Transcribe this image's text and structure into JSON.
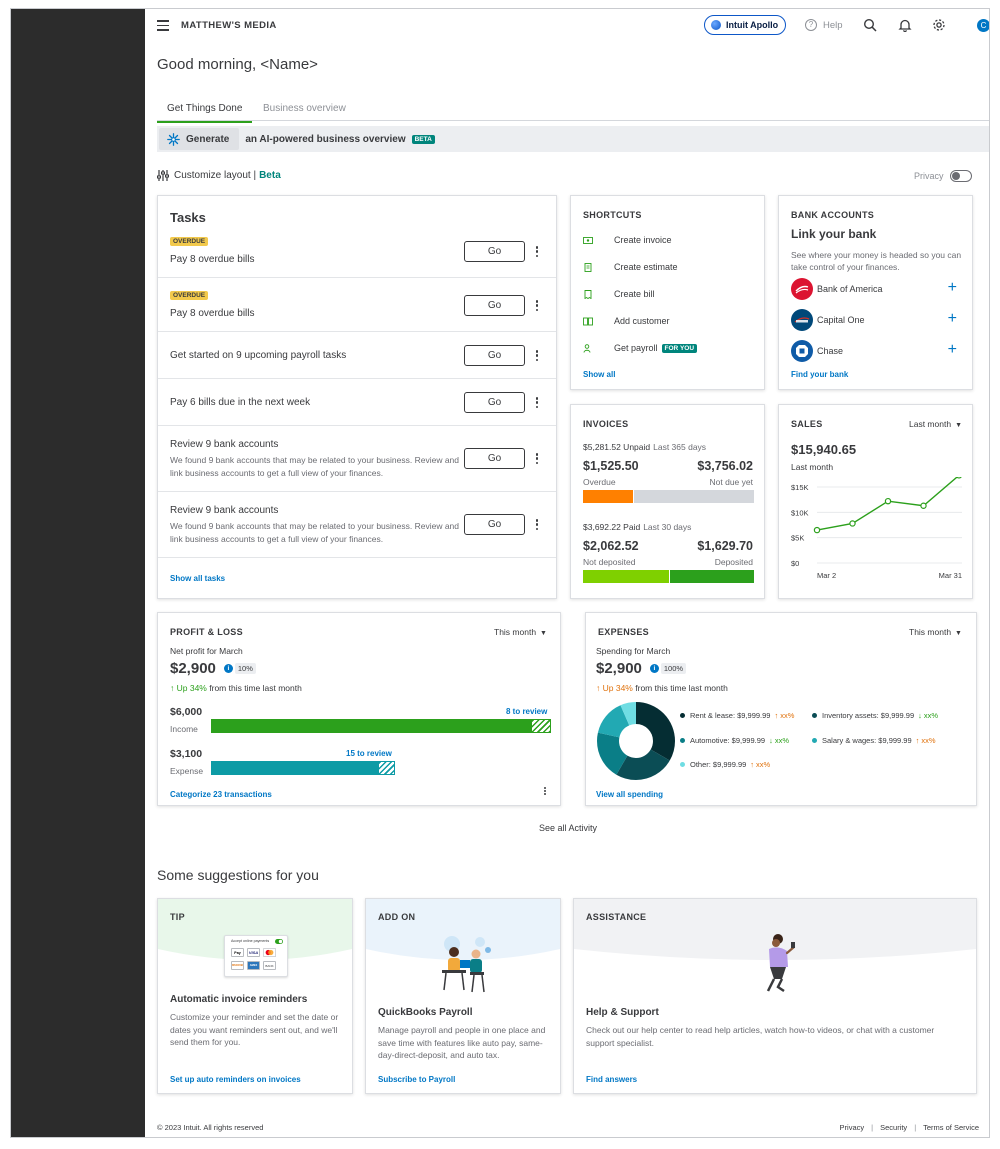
{
  "header": {
    "company": "MATTHEW'S MEDIA",
    "apollo": "Intuit Apollo",
    "help": "Help",
    "avatar": "C"
  },
  "greeting": "Good morning, <Name>",
  "tabs": [
    {
      "label": "Get Things Done",
      "active": true
    },
    {
      "label": "Business overview",
      "active": false
    }
  ],
  "generate": {
    "button": "Generate",
    "text": "an AI-powered business overview",
    "badge": "BETA"
  },
  "customize": {
    "label": "Customize layout |",
    "beta": "Beta"
  },
  "privacy": {
    "label": "Privacy",
    "enabled": false
  },
  "tasks": {
    "title": "Tasks",
    "go_label": "Go",
    "items": [
      {
        "badge": "OVERDUE",
        "title": "Pay 8 overdue bills",
        "description": ""
      },
      {
        "badge": "OVERDUE",
        "title": "Pay 8 overdue bills",
        "description": ""
      },
      {
        "badge": "",
        "title": "Get started on 9 upcoming payroll tasks",
        "description": ""
      },
      {
        "badge": "",
        "title": "Pay 6 bills due in the next week",
        "description": ""
      },
      {
        "badge": "",
        "title": "Review 9 bank accounts",
        "description": "We found 9 bank accounts that may be related to your business. Review and link business accounts to get a full view of your finances."
      },
      {
        "badge": "",
        "title": "Review 9 bank accounts",
        "description": "We found 9 bank accounts that may be related to your business. Review and link business accounts to get a full view of your finances."
      }
    ],
    "show_all": "Show all tasks"
  },
  "shortcuts": {
    "title": "SHORTCUTS",
    "items": [
      {
        "label": "Create invoice",
        "icon": "invoice-icon",
        "badge": ""
      },
      {
        "label": "Create estimate",
        "icon": "estimate-icon",
        "badge": ""
      },
      {
        "label": "Create bill",
        "icon": "bill-icon",
        "badge": ""
      },
      {
        "label": "Add customer",
        "icon": "customer-icon",
        "badge": ""
      },
      {
        "label": "Get payroll",
        "icon": "payroll-icon",
        "badge": "FOR YOU"
      }
    ],
    "show_all": "Show all"
  },
  "bank_accounts": {
    "title": "BANK ACCOUNTS",
    "heading": "Link your bank",
    "description": "See where your money is headed so you can take control of your finances.",
    "banks": [
      {
        "name": "Bank of America",
        "color": "#dc1431"
      },
      {
        "name": "Capital One",
        "color": "#004879"
      },
      {
        "name": "Chase",
        "color": "#0f5ba7"
      }
    ],
    "find": "Find your bank"
  },
  "invoices": {
    "title": "INVOICES",
    "unpaid_amount": "$5,281.52 Unpaid",
    "unpaid_period": "Last 365 days",
    "overdue_value": "$1,525.50",
    "overdue_label": "Overdue",
    "not_due_value": "$3,756.02",
    "not_due_label": "Not due yet",
    "paid_amount": "$3,692.22 Paid",
    "paid_period": "Last 30 days",
    "not_deposited_value": "$2,062.52",
    "not_deposited_label": "Not deposited",
    "deposited_value": "$1,629.70",
    "deposited_label": "Deposited",
    "colors": {
      "overdue": "#ff8000",
      "not_due": "#d4d7dc",
      "not_deposited": "#7fd000",
      "deposited": "#2ca01c"
    }
  },
  "sales": {
    "title": "SALES",
    "period": "Last month",
    "total": "$15,940.65",
    "total_label": "Last month"
  },
  "chart_data": {
    "type": "line",
    "title": "",
    "x": [
      "Mar 2",
      "",
      "",
      "",
      "",
      "Mar 31"
    ],
    "xticks": [
      "Mar 2",
      "Mar 31"
    ],
    "values": [
      6500,
      7800,
      12200,
      11300,
      17300
    ],
    "yticks": [
      "$0",
      "$5K",
      "$10K",
      "$15K"
    ],
    "ylim": [
      0,
      15000
    ],
    "color": "#2ca01c"
  },
  "profit_loss": {
    "title": "PROFIT & LOSS",
    "period": "This month",
    "subtitle": "Net profit for March",
    "net": "$2,900",
    "pct": "10%",
    "change": "Up 34%",
    "change_suffix": "from this time last month",
    "income_value": "$6,000",
    "income_label": "Income",
    "income_review": "8 to review",
    "income_fill": 0.94,
    "expense_value": "$3,100",
    "expense_label": "Expense",
    "expense_review": "15 to review",
    "expense_fill": 0.49,
    "categorize": "Categorize 23 transactions",
    "colors": {
      "income": "#2ca01c",
      "expense": "#0d9ba5"
    }
  },
  "expenses": {
    "title": "EXPENSES",
    "period": "This month",
    "subtitle": "Spending for March",
    "total": "$2,900",
    "pct": "100%",
    "change": "Up 34%",
    "change_suffix": "from this time last month",
    "legend": [
      {
        "label": "Rent & lease: $9,999.99",
        "trend": "xx%",
        "direction": "up",
        "color": "#052d33"
      },
      {
        "label": "Inventory assets: $9,999.99",
        "trend": "xx%",
        "direction": "down",
        "color": "#0b4d55"
      },
      {
        "label": "Automotive: $9,999.99",
        "trend": "xx%",
        "direction": "down",
        "color": "#0a7e87"
      },
      {
        "label": "Salary & wages: $9,999.99",
        "trend": "xx%",
        "direction": "up",
        "color": "#22a9b3"
      },
      {
        "label": "Other: $9,999.99",
        "trend": "xx%",
        "direction": "up",
        "color": "#6fdde3"
      }
    ],
    "view_all": "View all spending"
  },
  "see_all": "See all Activity",
  "suggestions": {
    "title": "Some suggestions for you",
    "cards": [
      {
        "label": "TIP",
        "heading": "Automatic invoice reminders",
        "body": "Customize your reminder and set the date or dates you want reminders sent out, and we'll send them for you.",
        "link": "Set up auto reminders on invoices",
        "promo": "Accept online payments",
        "brands": [
          "Pay",
          "VISA",
          "",
          "DISCOVER",
          "AMEX",
          "BANK"
        ]
      },
      {
        "label": "ADD ON",
        "heading": "QuickBooks Payroll",
        "body": "Manage payroll and people in one place and save time with features like auto pay, same-day-direct-deposit, and auto tax.",
        "link": "Subscribe to Payroll"
      },
      {
        "label": "ASSISTANCE",
        "heading": "Help & Support",
        "body": "Check out our help center to read help articles, watch how-to videos, or chat with a customer support specialist.",
        "link": "Find answers"
      }
    ]
  },
  "footer": {
    "copyright": "© 2023 Intuit. All rights reserved",
    "links": [
      "Privacy",
      "Security",
      "Terms of Service"
    ]
  }
}
